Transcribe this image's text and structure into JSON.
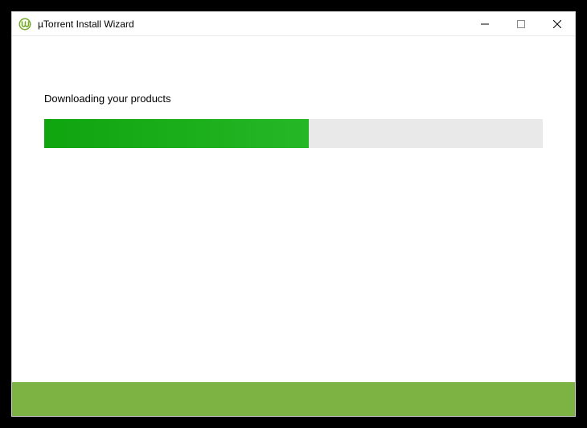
{
  "window": {
    "title": "µTorrent Install Wizard"
  },
  "content": {
    "status": "Downloading your products"
  },
  "progress": {
    "percent": 53
  },
  "colors": {
    "progress_fill": "#1da51d",
    "footer": "#7cb342"
  }
}
